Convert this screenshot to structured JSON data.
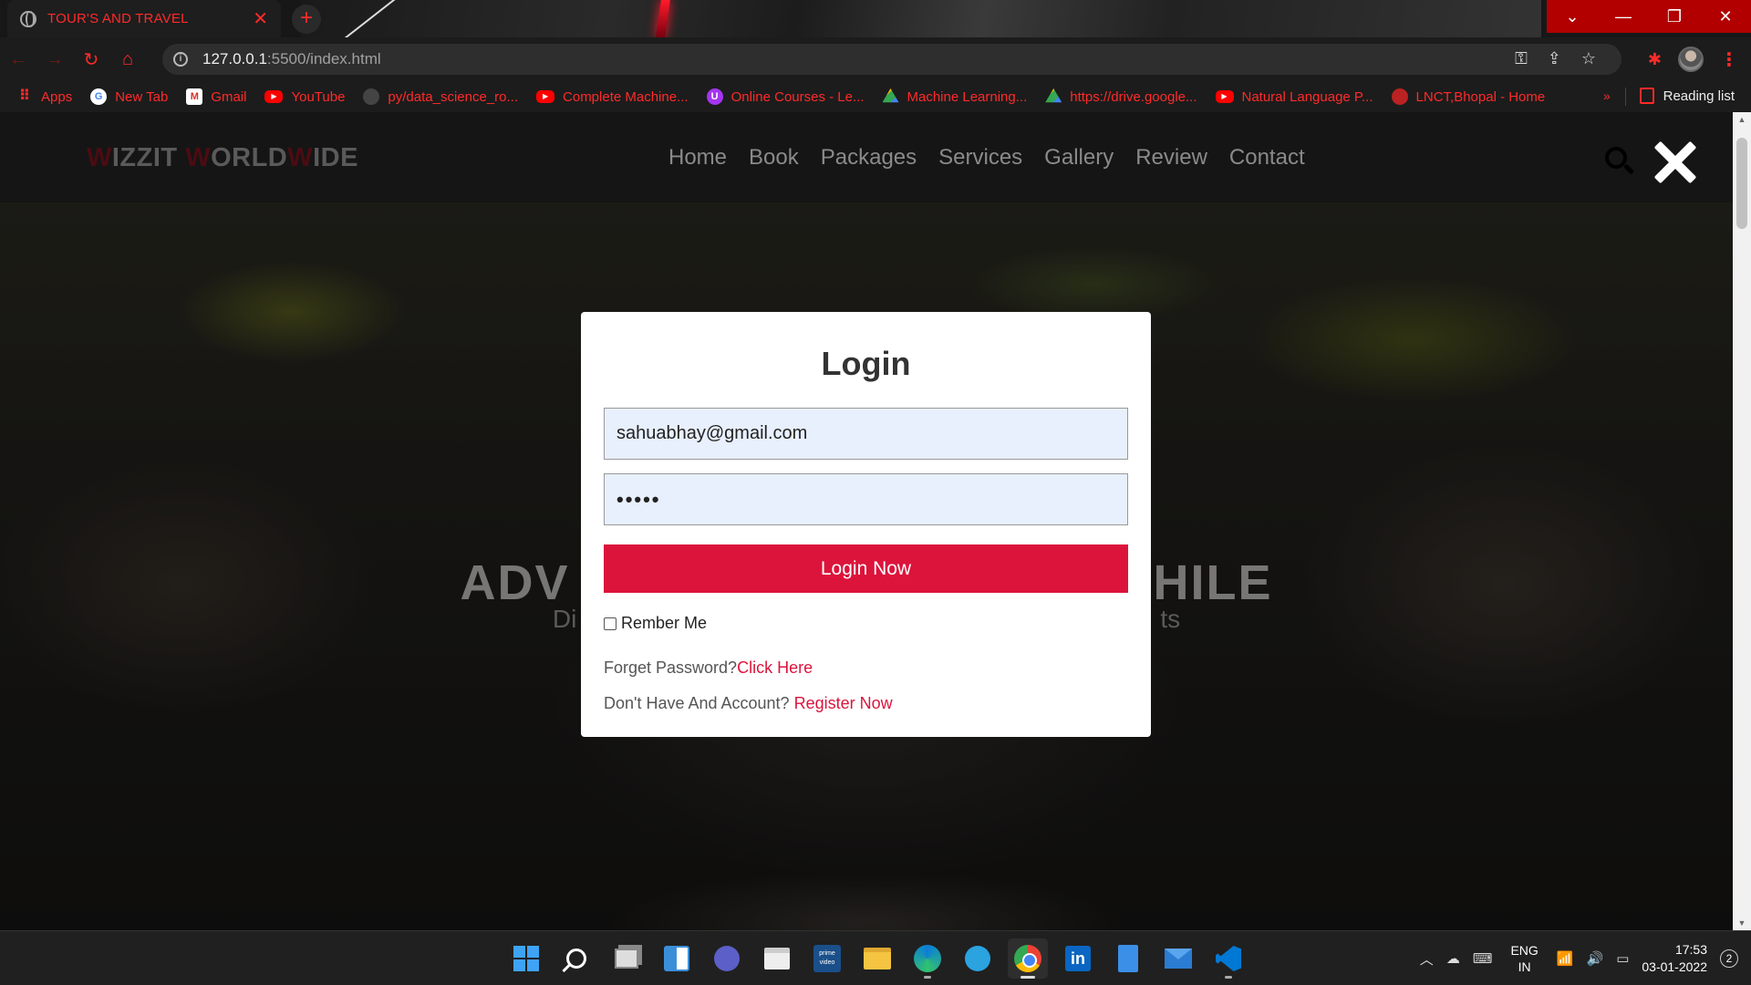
{
  "browser": {
    "tab_title": "TOUR'S AND TRAVEL",
    "tab_close": "✕",
    "new_tab": "+",
    "url_host": "127.0.0.1",
    "url_path": ":5500/index.html",
    "bookmarks": [
      {
        "label": "Apps",
        "icon": "apps-grid-icon"
      },
      {
        "label": "New Tab",
        "icon": "google-icon"
      },
      {
        "label": "Gmail",
        "icon": "gmail-icon"
      },
      {
        "label": "YouTube",
        "icon": "youtube-icon"
      },
      {
        "label": "py/data_science_ro...",
        "icon": "github-icon"
      },
      {
        "label": "Complete Machine...",
        "icon": "youtube-icon"
      },
      {
        "label": "Online Courses - Le...",
        "icon": "udemy-icon"
      },
      {
        "label": "Machine Learning...",
        "icon": "google-drive-icon"
      },
      {
        "label": "https://drive.google...",
        "icon": "google-drive-icon"
      },
      {
        "label": "Natural Language P...",
        "icon": "youtube-icon"
      },
      {
        "label": "LNCT,Bhopal - Home",
        "icon": "lnct-icon"
      }
    ],
    "bookmarks_more": "»",
    "reading_list": "Reading list",
    "accent_color": "#ff2a2a"
  },
  "site": {
    "logo": {
      "w1": "W",
      "r1": "IZZIT ",
      "w2": "W",
      "r2": "ORLD",
      "w3": "W",
      "r3": "IDE"
    },
    "nav": [
      "Home",
      "Book",
      "Packages",
      "Services",
      "Gallery",
      "Review",
      "Contact"
    ],
    "hero": {
      "heading_left": "ADV",
      "heading_right": "HILE",
      "sub_left": "Di",
      "sub_right": "ts"
    }
  },
  "login": {
    "title": "Login",
    "email_value": "sahuabhay@gmail.com",
    "password_value": "•••••",
    "submit_label": "Login Now",
    "remember_label": "Rember Me",
    "forgot_text": "Forget Password?",
    "forgot_link": "Click Here",
    "register_text": "Don't Have And Account? ",
    "register_link": "Register Now",
    "accent_color": "#dc143c"
  },
  "taskbar": {
    "lang_top": "ENG",
    "lang_bottom": "IN",
    "time": "17:53",
    "date": "03-01-2022",
    "notifications": "2",
    "prime_label": "prime video",
    "linkedin_label": "in"
  }
}
